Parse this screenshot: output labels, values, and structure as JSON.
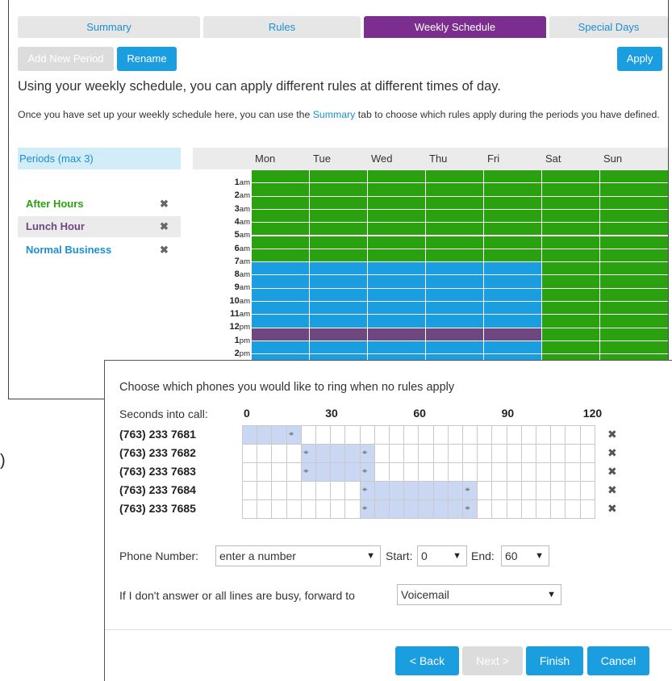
{
  "colors": {
    "after_hours": "#2aa10f",
    "lunch_hour": "#6e4680",
    "normal_business": "#1a9ee0",
    "active_tab": "#7b2e8e",
    "coverage": "#cad7f2"
  },
  "tabs": [
    {
      "label": "Summary",
      "active": false
    },
    {
      "label": "Rules",
      "active": false
    },
    {
      "label": "Weekly Schedule",
      "active": true
    },
    {
      "label": "Special Days",
      "active": false
    }
  ],
  "toolbar": {
    "add_period": "Add New Period",
    "rename": "Rename",
    "apply": "Apply"
  },
  "intro": {
    "heading": "Using your weekly schedule, you can apply different rules at different times of day.",
    "line_before": "Once you have set up your weekly schedule here, you can use the",
    "link": "Summary",
    "line_after": "tab to choose which rules apply during the periods you have defined."
  },
  "periods": {
    "header": "Periods (max 3)",
    "items": [
      {
        "label": "After Hours",
        "color": "#2aa10f",
        "selected": false
      },
      {
        "label": "Lunch Hour",
        "color": "#6e4680",
        "selected": true
      },
      {
        "label": "Normal Business",
        "color": "#1a8fd1",
        "selected": false
      }
    ],
    "remove_icon": "✖"
  },
  "schedule": {
    "days": [
      "Mon",
      "Tue",
      "Wed",
      "Thu",
      "Fri",
      "Sat",
      "Sun"
    ],
    "hours": [
      {
        "h": "1",
        "ap": "am"
      },
      {
        "h": "2",
        "ap": "am"
      },
      {
        "h": "3",
        "ap": "am"
      },
      {
        "h": "4",
        "ap": "am"
      },
      {
        "h": "5",
        "ap": "am"
      },
      {
        "h": "6",
        "ap": "am"
      },
      {
        "h": "7",
        "ap": "am"
      },
      {
        "h": "8",
        "ap": "am"
      },
      {
        "h": "9",
        "ap": "am"
      },
      {
        "h": "10",
        "ap": "am"
      },
      {
        "h": "11",
        "ap": "am"
      },
      {
        "h": "12",
        "ap": "pm"
      },
      {
        "h": "1",
        "ap": "pm"
      },
      {
        "h": "2",
        "ap": "pm"
      }
    ],
    "weekday_pattern": [
      "A",
      "A",
      "A",
      "A",
      "A",
      "A",
      "A",
      "N",
      "N",
      "N",
      "N",
      "N",
      "L",
      "N",
      "N"
    ],
    "weekend_pattern": [
      "A",
      "A",
      "A",
      "A",
      "A",
      "A",
      "A",
      "A",
      "A",
      "A",
      "A",
      "A",
      "A",
      "A",
      "A"
    ]
  },
  "stray_text": ")",
  "dialog": {
    "title": "Choose which phones you would like to ring when no rules apply",
    "seconds_label": "Seconds into call:",
    "ticks": [
      "0",
      "30",
      "60",
      "90",
      "120"
    ],
    "phones": [
      {
        "number": "(763) 233 7681",
        "start": 0,
        "end": 20
      },
      {
        "number": "(763) 233 7682",
        "start": 20,
        "end": 45
      },
      {
        "number": "(763) 233 7683",
        "start": 20,
        "end": 45
      },
      {
        "number": "(763) 233 7684",
        "start": 40,
        "end": 80
      },
      {
        "number": "(763) 233 7685",
        "start": 40,
        "end": 80
      }
    ],
    "handle_glyph": "◂▸",
    "remove_icon": "✖",
    "phone_number_label": "Phone Number:",
    "phone_number_placeholder": "enter a number",
    "start_label": "Start:",
    "start_value": "0",
    "end_label": "End:",
    "end_value": "60",
    "forward_label": "If I don't answer or all lines are busy, forward to",
    "forward_value": "Voicemail",
    "buttons": {
      "back": "< Back",
      "next": "Next >",
      "finish": "Finish",
      "cancel": "Cancel"
    }
  }
}
